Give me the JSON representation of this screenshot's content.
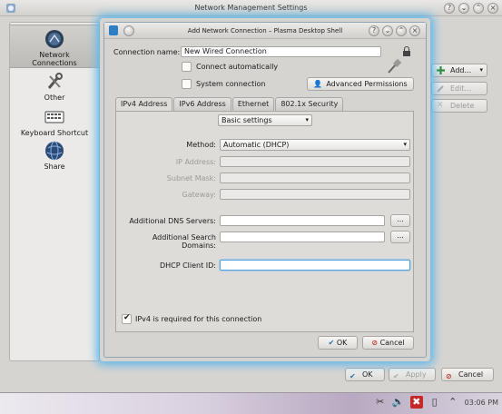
{
  "main_window": {
    "title": "Network Management Settings",
    "sidebar": [
      {
        "label_line1": "Network",
        "label_line2": "Connections",
        "icon": "network-icon"
      },
      {
        "label_line1": "Other",
        "label_line2": "",
        "icon": "tools-icon"
      },
      {
        "label_line1": "Keyboard Shortcut",
        "label_line2": "",
        "icon": "keyboard-icon"
      },
      {
        "label_line1": "Share",
        "label_line2": "",
        "icon": "globe-icon"
      }
    ],
    "right_buttons": {
      "add": "Add...",
      "edit": "Edit...",
      "delete": "Delete"
    },
    "bottom_buttons": {
      "ok": "OK",
      "apply": "Apply",
      "cancel": "Cancel"
    }
  },
  "dialog": {
    "title": "Add Network Connection – Plasma Desktop Shell",
    "connection_name_label": "Connection name:",
    "connection_name_value": "New Wired Connection",
    "connect_automatically": {
      "label": "Connect automatically",
      "checked": false
    },
    "system_connection": {
      "label": "System connection",
      "checked": false
    },
    "advanced_permissions": "Advanced Permissions",
    "tabs": [
      "IPv4 Address",
      "IPv6 Address",
      "Ethernet",
      "802.1x Security"
    ],
    "active_tab": "IPv4 Address",
    "settings_combo": "Basic settings",
    "method_label": "Method:",
    "method_value": "Automatic (DHCP)",
    "ip_address_label": "IP Address:",
    "subnet_mask_label": "Subnet Mask:",
    "gateway_label": "Gateway:",
    "dns_label": "Additional DNS Servers:",
    "search_domains_label": "Additional Search Domains:",
    "dhcp_client_id_label": "DHCP Client ID:",
    "browse_button": "...",
    "ipv4_required": {
      "label": "IPv4 is required for this connection",
      "checked": true
    },
    "ok": "OK",
    "cancel": "Cancel"
  },
  "taskbar": {
    "clock": "03:06 PM"
  }
}
